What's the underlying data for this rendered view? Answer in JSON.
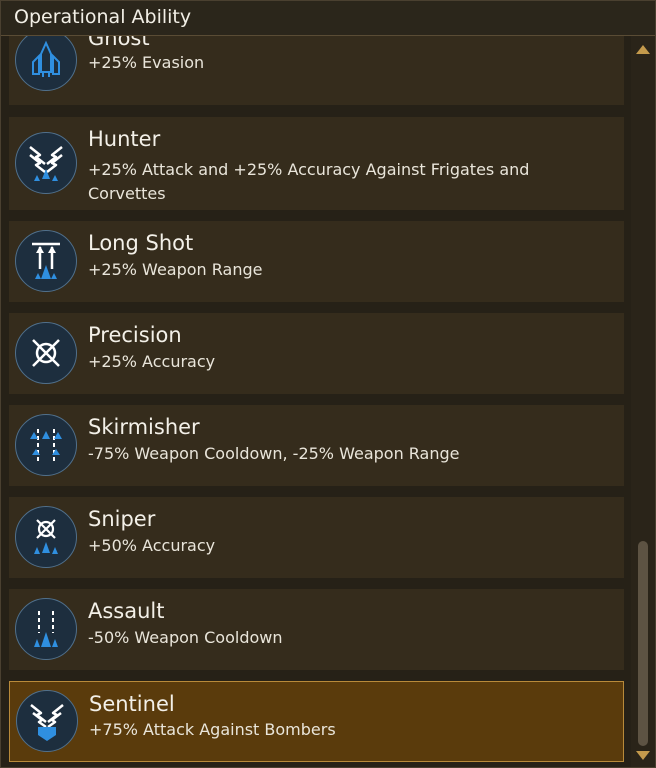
{
  "window": {
    "title": "Operational Ability"
  },
  "abilities": [
    {
      "name": "Ghost",
      "description": "+25% Evasion",
      "icon": "ghost-ship-icon"
    },
    {
      "name": "Hunter",
      "description": "+25% Attack and +25% Accuracy Against Frigates and Corvettes",
      "icon": "hunter-lightning-icon"
    },
    {
      "name": "Long Shot",
      "description": "+25% Weapon Range",
      "icon": "long-shot-range-icon"
    },
    {
      "name": "Precision",
      "description": "+25% Accuracy",
      "icon": "crosshair-icon"
    },
    {
      "name": "Skirmisher",
      "description": "-75% Weapon Cooldown, -25% Weapon Range",
      "icon": "skirmisher-icon"
    },
    {
      "name": "Sniper",
      "description": "+50% Accuracy",
      "icon": "sniper-crosshair-icon"
    },
    {
      "name": "Assault",
      "description": "-50% Weapon Cooldown",
      "icon": "assault-ship-icon"
    },
    {
      "name": "Sentinel",
      "description": "+75% Attack Against Bombers",
      "icon": "sentinel-shield-icon",
      "selected": true
    }
  ],
  "colors": {
    "accent": "#c49a4c",
    "selected": "#5a3b0c",
    "icon_blue": "#2f8fe0"
  }
}
